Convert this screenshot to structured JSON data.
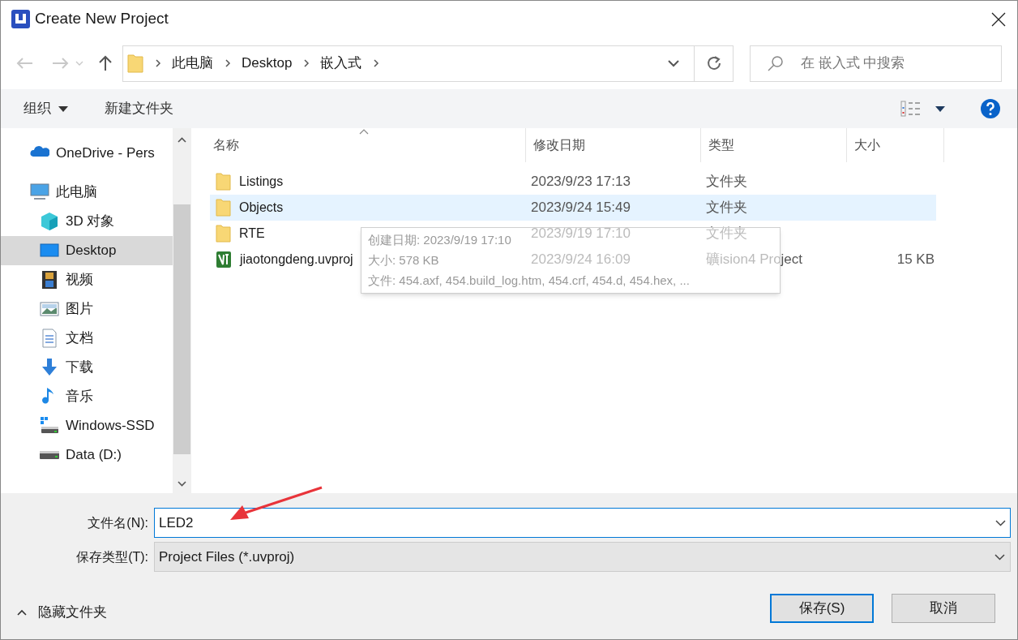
{
  "window": {
    "title": "Create New Project"
  },
  "nav": {
    "back": {
      "disabled": true
    },
    "forward": {
      "disabled": true
    },
    "up": {
      "disabled": false
    },
    "breadcrumb": [
      "此电脑",
      "Desktop",
      "嵌入式"
    ],
    "search": {
      "placeholder": "在 嵌入式 中搜索"
    }
  },
  "toolbar": {
    "organize": "组织",
    "new_folder": "新建文件夹"
  },
  "sidebar": {
    "items": [
      {
        "label": "OneDrive - Pers",
        "kind": "cloud",
        "selected": false
      },
      {
        "label": "此电脑",
        "kind": "computer",
        "selected": false,
        "children": [
          {
            "label": "3D 对象",
            "kind": "cube",
            "selected": false
          },
          {
            "label": "Desktop",
            "kind": "desktop",
            "selected": true
          },
          {
            "label": "视频",
            "kind": "video",
            "selected": false
          },
          {
            "label": "图片",
            "kind": "image",
            "selected": false
          },
          {
            "label": "文档",
            "kind": "document",
            "selected": false
          },
          {
            "label": "下载",
            "kind": "download",
            "selected": false
          },
          {
            "label": "音乐",
            "kind": "music",
            "selected": false
          },
          {
            "label": "Windows-SSD",
            "kind": "system-drive",
            "selected": false
          },
          {
            "label": "Data (D:)",
            "kind": "drive",
            "selected": false
          }
        ]
      }
    ]
  },
  "table": {
    "columns": [
      "名称",
      "修改日期",
      "类型",
      "大小"
    ],
    "rows": [
      {
        "name": "Listings",
        "date": "2023/9/23 17:13",
        "type": "文件夹",
        "kind": "folder",
        "selected": false
      },
      {
        "name": "Objects",
        "date": "2023/9/24 15:49",
        "type": "文件夹",
        "kind": "folder",
        "selected": true
      },
      {
        "name": "RTE",
        "date": "2023/9/19 17:10",
        "type": "文件夹",
        "kind": "folder",
        "selected": false
      },
      {
        "name": "jiaotongdeng.uvproj",
        "date": "2023/9/24 16:09",
        "type": "礦ision4 Project",
        "size": "15 KB",
        "kind": "project",
        "selected": false
      }
    ]
  },
  "tooltip": {
    "lines": [
      "创建日期: 2023/9/19 17:10",
      "大小: 578 KB",
      "文件: 454.axf, 454.build_log.htm, 454.crf, 454.d, 454.hex, ..."
    ]
  },
  "file_name": {
    "label": "文件名(N):",
    "value": "LED2"
  },
  "file_type": {
    "label": "保存类型(T):",
    "value": "Project Files (*.uvproj)"
  },
  "hide_folders": {
    "label": "隐藏文件夹",
    "expanded": true
  },
  "buttons": [
    {
      "label": "保存(S)",
      "default": true
    },
    {
      "label": "取消",
      "default": false
    }
  ]
}
